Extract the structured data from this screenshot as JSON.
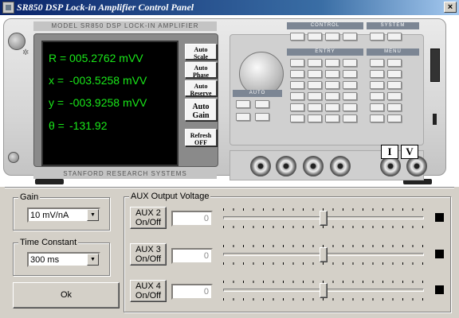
{
  "window": {
    "title": "SR850 DSP Lock-in Amplifier Control Panel",
    "close_label": "×"
  },
  "instrument": {
    "model_label": "MODEL SR850 DSP LOCK-IN AMPLIFIER",
    "maker_label": "STANFORD RESEARCH SYSTEMS",
    "display": {
      "rows": [
        {
          "label": "R =",
          "value": "005.2762 mVV"
        },
        {
          "label": "x =",
          "value": "-003.5258 mVV"
        },
        {
          "label": "y =",
          "value": "-003.9258 mVV"
        },
        {
          "label": "θ =",
          "value": "-131.92"
        }
      ]
    },
    "soft_keys": [
      {
        "line1": "Auto",
        "line2": "Scale"
      },
      {
        "line1": "Auto",
        "line2": "Phase"
      },
      {
        "line1": "Auto",
        "line2": "Reserve"
      },
      {
        "line1": "Auto",
        "line2": "Gain"
      },
      {
        "line1": "Refresh",
        "line2": "OFF"
      }
    ],
    "panel_sections": {
      "control": "CONTROL",
      "system": "SYSTEM",
      "entry": "ENTRY",
      "menu": "MENU",
      "auto": "AUTO"
    },
    "iv_buttons": [
      "I",
      "V"
    ]
  },
  "controls": {
    "gain": {
      "label": "Gain",
      "selected": "10 mV/nA"
    },
    "time_constant": {
      "label": "Time Constant",
      "selected": "300 ms"
    },
    "ok_label": "Ok",
    "aux": {
      "group_label": "AUX Output Voltage",
      "channels": [
        {
          "button_line1": "AUX 2",
          "button_line2": "On/Off",
          "value": "0",
          "slider_level": 0.5
        },
        {
          "button_line1": "AUX 3",
          "button_line2": "On/Off",
          "value": "0",
          "slider_level": 0.5
        },
        {
          "button_line1": "AUX 4",
          "button_line2": "On/Off",
          "value": "0",
          "slider_level": 0.5
        }
      ]
    }
  }
}
